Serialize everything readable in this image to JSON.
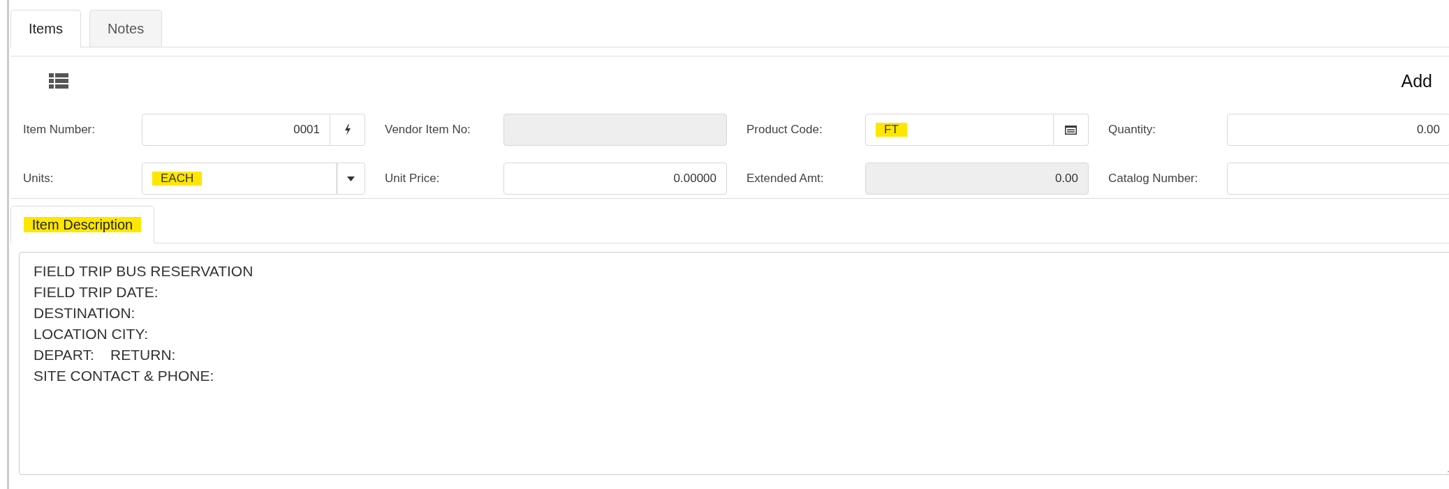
{
  "tabs": [
    {
      "label": "Items",
      "selected": true
    },
    {
      "label": "Notes",
      "selected": false
    }
  ],
  "toolbar": {
    "action": "Add"
  },
  "fields": [
    {
      "label": "Item Number:",
      "kind": "generate",
      "value": "0001"
    },
    {
      "label": "Vendor Item No:",
      "kind": "disabled"
    },
    {
      "label": "Product Code:",
      "kind": "lookup",
      "value": "FT",
      "highlighted": true
    },
    {
      "label": "Quantity:",
      "kind": "number",
      "value": "0.00"
    },
    {
      "label": "Units:",
      "kind": "select",
      "value": "EACH",
      "highlighted": true
    },
    {
      "label": "Unit Price:",
      "kind": "number",
      "value": "0.00000"
    },
    {
      "label": "Extended Amt:",
      "kind": "disabled",
      "value": "0.00"
    },
    {
      "label": "Catalog Number:",
      "kind": "number"
    }
  ],
  "description_tabs": [
    {
      "label": "Item Description",
      "selected": true,
      "highlighted": true
    }
  ],
  "description": {
    "value": "FIELD TRIP BUS RESERVATION\nFIELD TRIP DATE:\nDESTINATION:\nLOCATION CITY:\nDEPART:    RETURN:\nSITE CONTACT & PHONE:"
  }
}
